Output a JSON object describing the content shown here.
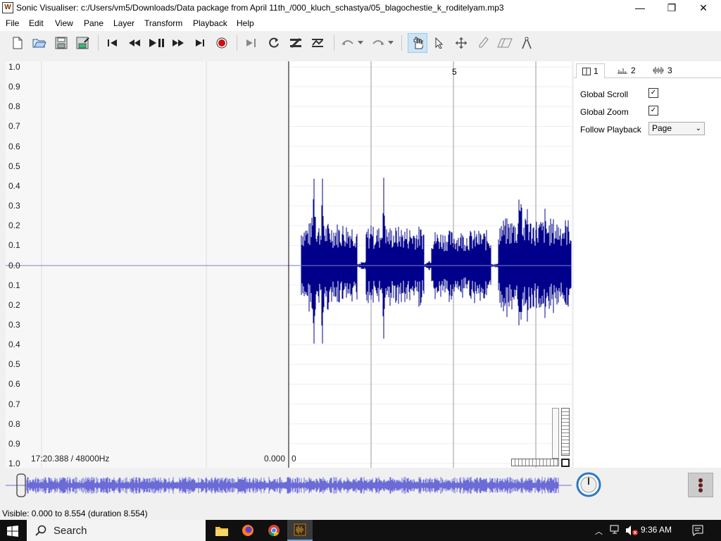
{
  "app": {
    "title": "Sonic Visualiser: c:/Users/vm5/Downloads/Data package from April 11th_/000_kluch_schastya/05_blagochestie_k_roditelyam.mp3",
    "icon_glyph": "W"
  },
  "window_controls": {
    "minimize": "—",
    "maximize": "❐",
    "close": "✕"
  },
  "menu": [
    "File",
    "Edit",
    "View",
    "Pane",
    "Layer",
    "Transform",
    "Playback",
    "Help"
  ],
  "toolbar": {
    "file": [
      "new-file-icon",
      "open-file-icon",
      "save-file-icon",
      "save-as-icon"
    ],
    "transport": [
      "rewind-start-icon",
      "rewind-icon",
      "play-pause-icon",
      "fast-forward-icon",
      "fast-forward-end-icon",
      "record-icon"
    ],
    "modes": [
      "constrain-selection-icon",
      "loop-icon",
      "solo-icon",
      "align-icon"
    ],
    "edit": [
      "undo-icon",
      "redo-icon"
    ],
    "tools": [
      "navigate-tool-icon",
      "select-tool-icon",
      "move-tool-icon",
      "draw-tool-icon",
      "erase-tool-icon",
      "measure-tool-icon"
    ],
    "active_tool": "navigate-tool-icon"
  },
  "pane": {
    "scale_labels": [
      "1.0",
      "0.9",
      "0.8",
      "0.7",
      "0.6",
      "0.5",
      "0.4",
      "0.3",
      "0.2",
      "0.1",
      "0.0",
      "0.1",
      "0.2",
      "0.3",
      "0.4",
      "0.5",
      "0.6",
      "0.7",
      "0.8",
      "0.9",
      "1.0"
    ],
    "time_label": "5",
    "position_info": "17:20.388 / 48000Hz",
    "cursor_time": "0.000",
    "frame_label": "0",
    "waveform_color": "#00008b",
    "background_left": "#f7f7f7",
    "background_right": "#ffffff"
  },
  "properties": {
    "tabs": [
      {
        "label": "1",
        "icon": "pane-icon"
      },
      {
        "label": "2",
        "icon": "ruler-icon"
      },
      {
        "label": "3",
        "icon": "waveform-icon"
      }
    ],
    "global_scroll": {
      "label": "Global Scroll",
      "checked": "✓"
    },
    "global_zoom": {
      "label": "Global Zoom",
      "checked": "✓"
    },
    "follow_playback": {
      "label": "Follow Playback",
      "value": "Page"
    }
  },
  "overview": {
    "waveform_color": "#6b6bd8"
  },
  "status": {
    "text": "Visible: 0.000 to 8.554 (duration 8.554)"
  },
  "taskbar": {
    "search_placeholder": "Search",
    "clock": "9:36 AM",
    "apps": [
      "file-explorer-icon",
      "firefox-icon",
      "chrome-icon",
      "sonic-visualiser-icon"
    ]
  }
}
